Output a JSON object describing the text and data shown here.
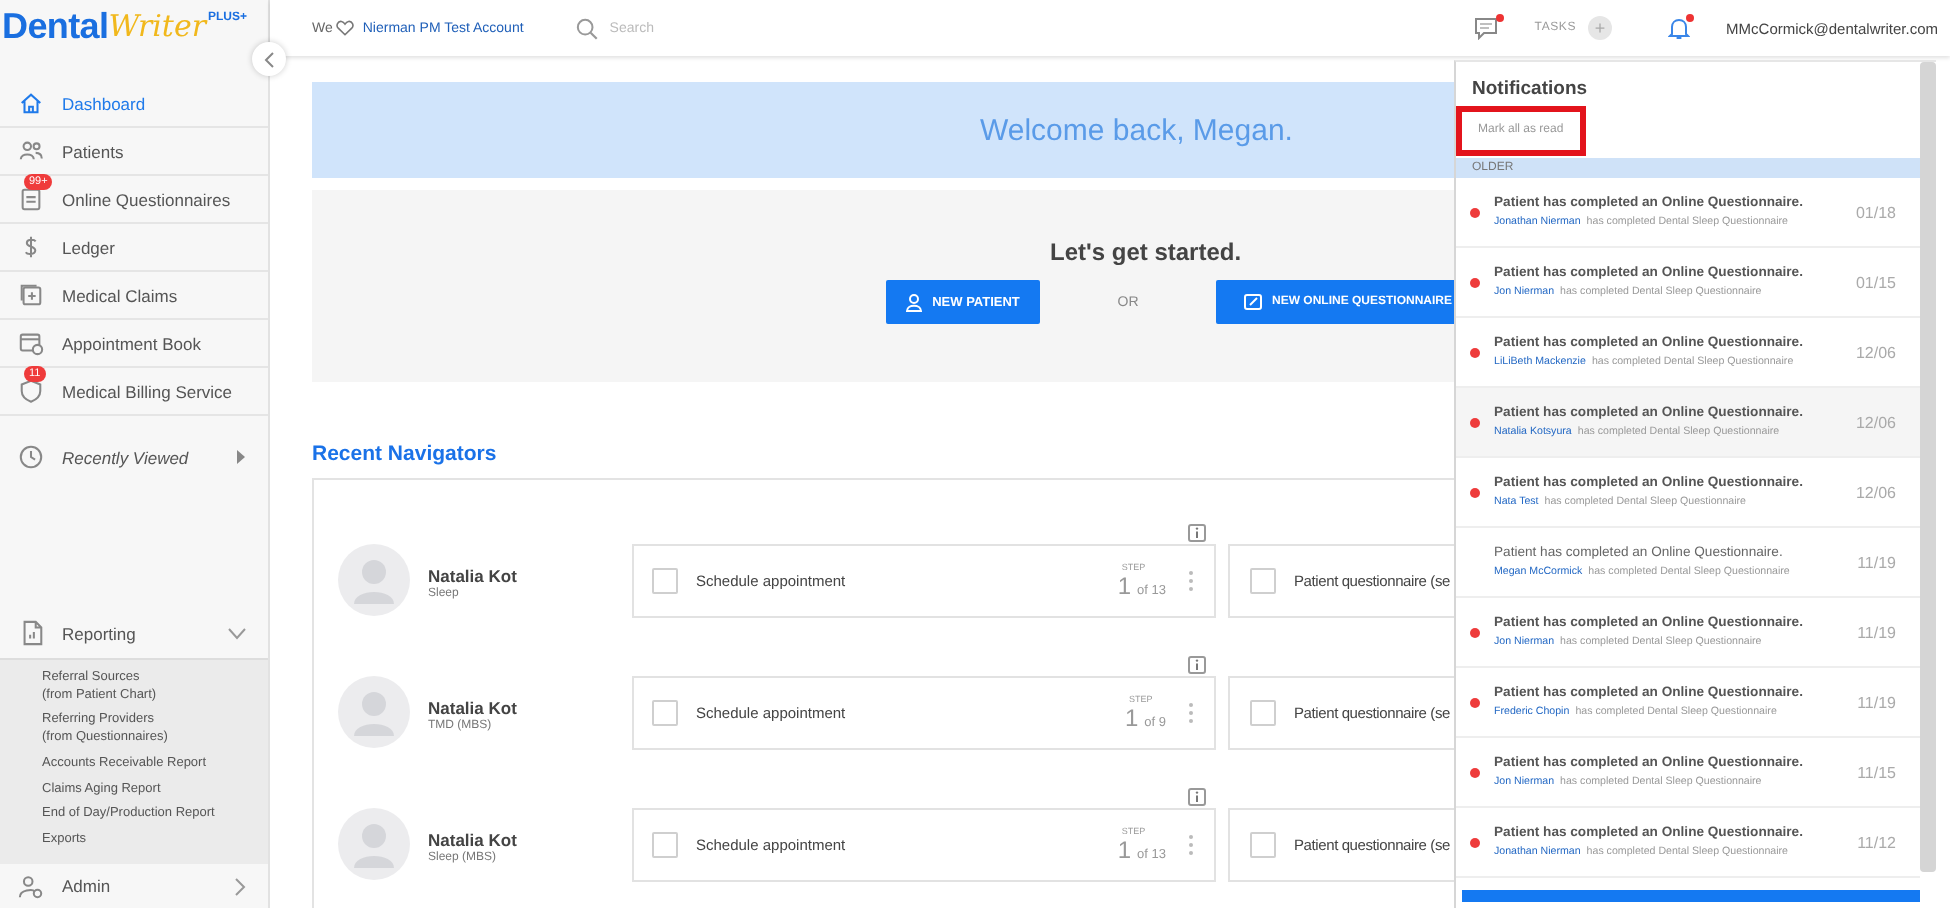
{
  "logo": {
    "word": "Dental",
    "script": "Writer",
    "badge": "PLUS+"
  },
  "topbar": {
    "account_prefix": "We",
    "account": "Nierman PM Test Account",
    "search": {
      "placeholder": "Search"
    },
    "sms_unread": true,
    "tasks_label": "TASKS",
    "tasks_add": "+",
    "bell_unread": true,
    "user": "MMcCormick@dentalwriter.com"
  },
  "sidebar": {
    "items": [
      {
        "label": "Dashboard",
        "selected": true
      },
      {
        "label": "Patients",
        "selected": false
      },
      {
        "label": "Online Questionnaires",
        "selected": false,
        "badge": "99+"
      },
      {
        "label": "Ledger",
        "selected": false
      },
      {
        "label": "Medical Claims",
        "selected": false
      },
      {
        "label": "Appointment Book",
        "selected": false
      },
      {
        "label": "Medical Billing Service",
        "selected": false,
        "badge": "11"
      }
    ],
    "recently_viewed": {
      "label": "Recently Viewed",
      "expanded": false
    },
    "reporting": {
      "label": "Reporting",
      "expanded": true,
      "children": [
        {
          "label": "Referral Sources\n(from Patient Chart)"
        },
        {
          "label": "Referring Providers\n(from Questionnaires)"
        },
        {
          "label": "Accounts Receivable Report"
        },
        {
          "label": "Claims Aging Report"
        },
        {
          "label": "End of Day/Production Report"
        },
        {
          "label": "Exports"
        }
      ]
    },
    "admin": {
      "label": "Admin"
    }
  },
  "welcome": "Welcome back, Megan.",
  "get_started": {
    "title": "Let's get started.",
    "new_patient": "NEW PATIENT",
    "or": "OR",
    "new_questionnaire": "NEW ONLINE QUESTIONNAIRE"
  },
  "navigators": {
    "title": "Recent Navigators",
    "rows": [
      {
        "name": "Natalia Kot",
        "program": "Sleep",
        "steps": [
          {
            "label": "Schedule appointment",
            "checked": false,
            "step_label": "STEP",
            "step": "1",
            "of": "of 13"
          },
          {
            "label": "Patient questionnaire (se",
            "checked": false
          }
        ]
      },
      {
        "name": "Natalia Kot",
        "program": "TMD (MBS)",
        "steps": [
          {
            "label": "Schedule appointment",
            "checked": false,
            "step_label": "STEP",
            "step": "1",
            "of": "of 9"
          },
          {
            "label": "Patient questionnaire (se",
            "checked": false
          }
        ]
      },
      {
        "name": "Natalia Kot",
        "program": "Sleep (MBS)",
        "steps": [
          {
            "label": "Schedule appointment",
            "checked": false,
            "step_label": "STEP",
            "step": "1",
            "of": "of 13"
          },
          {
            "label": "Patient questionnaire (se",
            "checked": false
          }
        ]
      }
    ]
  },
  "notifications": {
    "title": "Notifications",
    "mark_all": {
      "label": "Mark all as read",
      "outlined": true
    },
    "group": "OLDER",
    "items": [
      {
        "message": "Patient has completed an Online Questionnaire.",
        "patient": "Jonathan Nierman",
        "action": "has completed Dental Sleep Questionnaire",
        "date": "01/18",
        "unread": true,
        "hovered": false
      },
      {
        "message": "Patient has completed an Online Questionnaire.",
        "patient": "Jon Nierman",
        "action": "has completed Dental Sleep Questionnaire",
        "date": "01/15",
        "unread": true,
        "hovered": false
      },
      {
        "message": "Patient has completed an Online Questionnaire.",
        "patient": "LiLiBeth Mackenzie",
        "action": "has completed Dental Sleep Questionnaire",
        "date": "12/06",
        "unread": true,
        "hovered": false
      },
      {
        "message": "Patient has completed an Online Questionnaire.",
        "patient": "Natalia Kotsyura",
        "action": "has completed Dental Sleep Questionnaire",
        "date": "12/06",
        "unread": true,
        "hovered": true
      },
      {
        "message": "Patient has completed an Online Questionnaire.",
        "patient": "Nata Test",
        "action": "has completed Dental Sleep Questionnaire",
        "date": "12/06",
        "unread": true,
        "hovered": false
      },
      {
        "message": "Patient has completed an Online Questionnaire.",
        "patient": "Megan McCormick",
        "action": "has completed Dental Sleep Questionnaire",
        "date": "11/19",
        "unread": false,
        "hovered": false
      },
      {
        "message": "Patient has completed an Online Questionnaire.",
        "patient": "Jon Nierman",
        "action": "has completed Dental Sleep Questionnaire",
        "date": "11/19",
        "unread": true,
        "hovered": false
      },
      {
        "message": "Patient has completed an Online Questionnaire.",
        "patient": "Frederic Chopin",
        "action": "has completed Dental Sleep Questionnaire",
        "date": "11/19",
        "unread": true,
        "hovered": false
      },
      {
        "message": "Patient has completed an Online Questionnaire.",
        "patient": "Jon Nierman",
        "action": "has completed Dental Sleep Questionnaire",
        "date": "11/15",
        "unread": true,
        "hovered": false
      },
      {
        "message": "Patient has completed an Online Questionnaire.",
        "patient": "Jonathan Nierman",
        "action": "has completed Dental Sleep Questionnaire",
        "date": "11/12",
        "unread": true,
        "hovered": false
      }
    ]
  }
}
